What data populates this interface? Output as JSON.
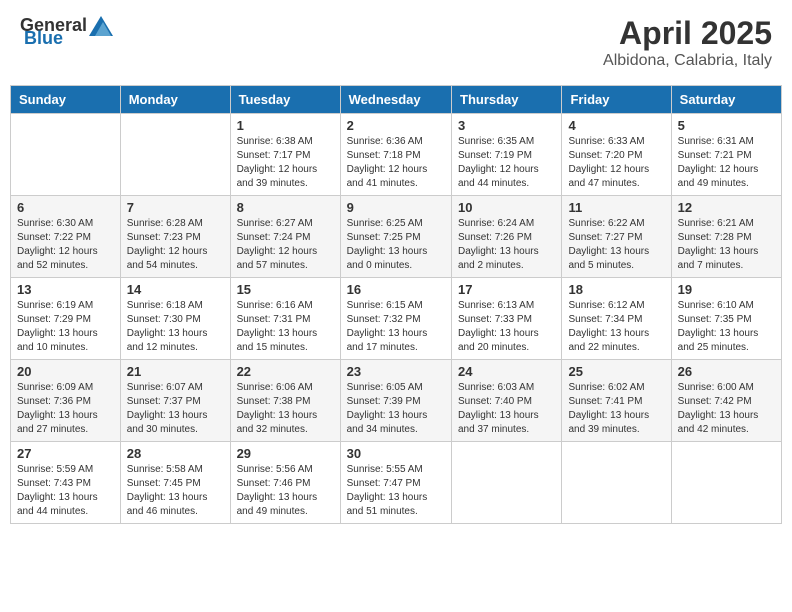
{
  "header": {
    "logo_general": "General",
    "logo_blue": "Blue",
    "month": "April 2025",
    "location": "Albidona, Calabria, Italy"
  },
  "weekdays": [
    "Sunday",
    "Monday",
    "Tuesday",
    "Wednesday",
    "Thursday",
    "Friday",
    "Saturday"
  ],
  "weeks": [
    [
      {
        "day": "",
        "info": ""
      },
      {
        "day": "",
        "info": ""
      },
      {
        "day": "1",
        "info": "Sunrise: 6:38 AM\nSunset: 7:17 PM\nDaylight: 12 hours and 39 minutes."
      },
      {
        "day": "2",
        "info": "Sunrise: 6:36 AM\nSunset: 7:18 PM\nDaylight: 12 hours and 41 minutes."
      },
      {
        "day": "3",
        "info": "Sunrise: 6:35 AM\nSunset: 7:19 PM\nDaylight: 12 hours and 44 minutes."
      },
      {
        "day": "4",
        "info": "Sunrise: 6:33 AM\nSunset: 7:20 PM\nDaylight: 12 hours and 47 minutes."
      },
      {
        "day": "5",
        "info": "Sunrise: 6:31 AM\nSunset: 7:21 PM\nDaylight: 12 hours and 49 minutes."
      }
    ],
    [
      {
        "day": "6",
        "info": "Sunrise: 6:30 AM\nSunset: 7:22 PM\nDaylight: 12 hours and 52 minutes."
      },
      {
        "day": "7",
        "info": "Sunrise: 6:28 AM\nSunset: 7:23 PM\nDaylight: 12 hours and 54 minutes."
      },
      {
        "day": "8",
        "info": "Sunrise: 6:27 AM\nSunset: 7:24 PM\nDaylight: 12 hours and 57 minutes."
      },
      {
        "day": "9",
        "info": "Sunrise: 6:25 AM\nSunset: 7:25 PM\nDaylight: 13 hours and 0 minutes."
      },
      {
        "day": "10",
        "info": "Sunrise: 6:24 AM\nSunset: 7:26 PM\nDaylight: 13 hours and 2 minutes."
      },
      {
        "day": "11",
        "info": "Sunrise: 6:22 AM\nSunset: 7:27 PM\nDaylight: 13 hours and 5 minutes."
      },
      {
        "day": "12",
        "info": "Sunrise: 6:21 AM\nSunset: 7:28 PM\nDaylight: 13 hours and 7 minutes."
      }
    ],
    [
      {
        "day": "13",
        "info": "Sunrise: 6:19 AM\nSunset: 7:29 PM\nDaylight: 13 hours and 10 minutes."
      },
      {
        "day": "14",
        "info": "Sunrise: 6:18 AM\nSunset: 7:30 PM\nDaylight: 13 hours and 12 minutes."
      },
      {
        "day": "15",
        "info": "Sunrise: 6:16 AM\nSunset: 7:31 PM\nDaylight: 13 hours and 15 minutes."
      },
      {
        "day": "16",
        "info": "Sunrise: 6:15 AM\nSunset: 7:32 PM\nDaylight: 13 hours and 17 minutes."
      },
      {
        "day": "17",
        "info": "Sunrise: 6:13 AM\nSunset: 7:33 PM\nDaylight: 13 hours and 20 minutes."
      },
      {
        "day": "18",
        "info": "Sunrise: 6:12 AM\nSunset: 7:34 PM\nDaylight: 13 hours and 22 minutes."
      },
      {
        "day": "19",
        "info": "Sunrise: 6:10 AM\nSunset: 7:35 PM\nDaylight: 13 hours and 25 minutes."
      }
    ],
    [
      {
        "day": "20",
        "info": "Sunrise: 6:09 AM\nSunset: 7:36 PM\nDaylight: 13 hours and 27 minutes."
      },
      {
        "day": "21",
        "info": "Sunrise: 6:07 AM\nSunset: 7:37 PM\nDaylight: 13 hours and 30 minutes."
      },
      {
        "day": "22",
        "info": "Sunrise: 6:06 AM\nSunset: 7:38 PM\nDaylight: 13 hours and 32 minutes."
      },
      {
        "day": "23",
        "info": "Sunrise: 6:05 AM\nSunset: 7:39 PM\nDaylight: 13 hours and 34 minutes."
      },
      {
        "day": "24",
        "info": "Sunrise: 6:03 AM\nSunset: 7:40 PM\nDaylight: 13 hours and 37 minutes."
      },
      {
        "day": "25",
        "info": "Sunrise: 6:02 AM\nSunset: 7:41 PM\nDaylight: 13 hours and 39 minutes."
      },
      {
        "day": "26",
        "info": "Sunrise: 6:00 AM\nSunset: 7:42 PM\nDaylight: 13 hours and 42 minutes."
      }
    ],
    [
      {
        "day": "27",
        "info": "Sunrise: 5:59 AM\nSunset: 7:43 PM\nDaylight: 13 hours and 44 minutes."
      },
      {
        "day": "28",
        "info": "Sunrise: 5:58 AM\nSunset: 7:45 PM\nDaylight: 13 hours and 46 minutes."
      },
      {
        "day": "29",
        "info": "Sunrise: 5:56 AM\nSunset: 7:46 PM\nDaylight: 13 hours and 49 minutes."
      },
      {
        "day": "30",
        "info": "Sunrise: 5:55 AM\nSunset: 7:47 PM\nDaylight: 13 hours and 51 minutes."
      },
      {
        "day": "",
        "info": ""
      },
      {
        "day": "",
        "info": ""
      },
      {
        "day": "",
        "info": ""
      }
    ]
  ]
}
